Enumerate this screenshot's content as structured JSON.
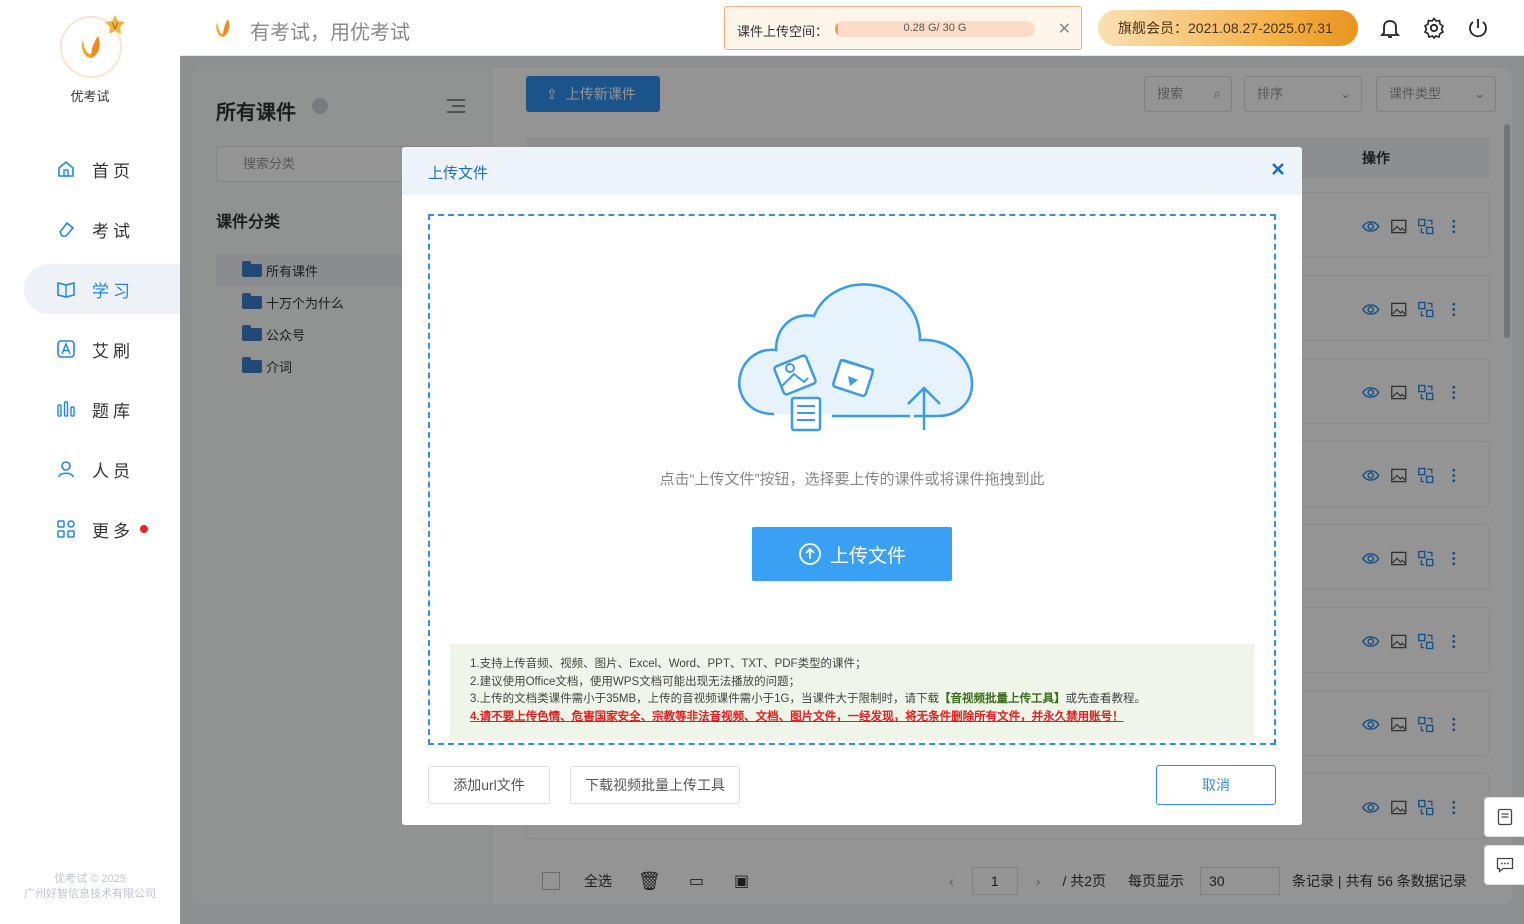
{
  "app": {
    "name": "优考试",
    "slogan": "有考试，用优考试",
    "copyright_line1": "优考试 © 2025",
    "copyright_line2": "广州好智信息技术有限公司"
  },
  "sidebar": {
    "items": [
      {
        "label": "首页",
        "icon": "home-icon"
      },
      {
        "label": "考试",
        "icon": "eraser-icon"
      },
      {
        "label": "学习",
        "icon": "book-icon",
        "active": true
      },
      {
        "label": "艾刷",
        "icon": "letter-a-icon"
      },
      {
        "label": "题库",
        "icon": "bar-chart-icon"
      },
      {
        "label": "人员",
        "icon": "user-icon"
      },
      {
        "label": "更多",
        "icon": "grid-icon",
        "has_dot": true
      }
    ]
  },
  "topbar": {
    "storage_label": "课件上传空间：",
    "storage_text": "0.28 G/ 30 G",
    "storage_fraction": 0.0093,
    "vip_text": "旗舰会员：2021.08.27-2025.07.31"
  },
  "left_panel": {
    "title": "所有课件",
    "search_placeholder": "搜索分类",
    "category_title": "课件分类",
    "tree": [
      "所有课件",
      "十万个为什么",
      "公众号",
      "介词"
    ]
  },
  "toolbar": {
    "upload_new": "上传新课件",
    "search": "搜索",
    "sort": "排序",
    "type": "课件类型"
  },
  "table": {
    "op_header": "操作"
  },
  "footer": {
    "select_all": "全选",
    "page": "1",
    "total_pages": "/ 共2页",
    "per_page_label": "每页显示",
    "per_page": "30",
    "records": "条记录 | 共有 56 条数据记录"
  },
  "dialog": {
    "title": "上传文件",
    "hint": "点击“上传文件”按钮，选择要上传的课件或将课件拖拽到此",
    "upload_button": "上传文件",
    "note1": "1.支持上传音频、视频、图片、Excel、Word、PPT、TXT、PDF类型的课件；",
    "note2": "2.建议使用Office文档，使用WPS文档可能出现无法播放的问题；",
    "note3_prefix": "3.上传的文档类课件需小于35MB，上传的音视频课件需小于1G，当课件大于限制时，请下载",
    "note3_link": "【音视频批量上传工具】",
    "note3_suffix": "或先查看教程。",
    "note4": "4.请不要上传色情、危害国家安全、宗教等非法音视频、文档、图片文件，一经发现，将无条件删除所有文件，并永久禁用账号！",
    "add_url": "添加url文件",
    "download_tool": "下载视频批量上传工具",
    "cancel": "取消"
  },
  "colors": {
    "accent": "#2f8ff0",
    "warning": "#e0211f",
    "storage_border": "#f1b070"
  }
}
